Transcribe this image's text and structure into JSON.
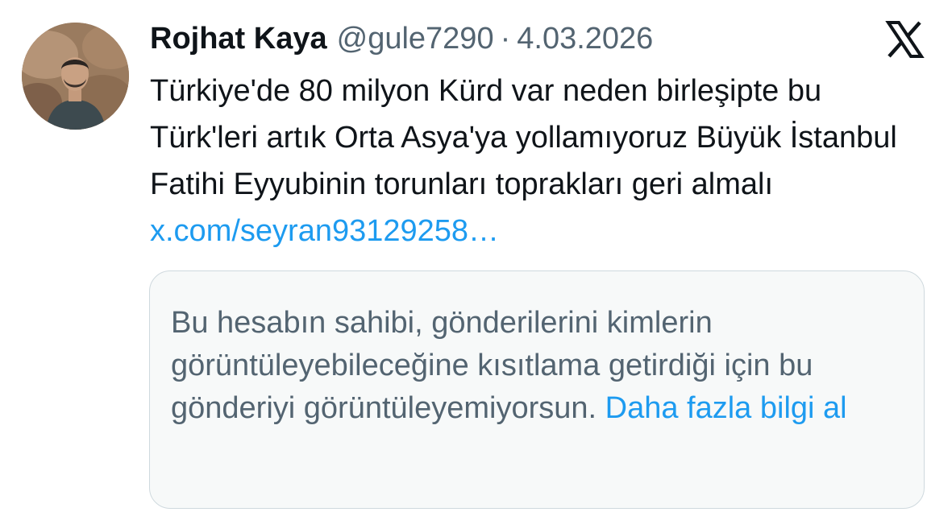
{
  "tweet": {
    "author": {
      "name": "Rojhat Kaya",
      "handle": "@gule7290",
      "avatar_icon": "profile-photo"
    },
    "separator": "·",
    "date": "4.03.2026",
    "brand_icon": "x-logo-icon",
    "text": "Türkiye'de 80 milyon Kürd var neden birleşipte bu Türk'leri artık Orta Asya'ya yollamıyoruz Büyük İstanbul Fatihi Eyyubinin torunları toprakları geri almalı",
    "link": "x.com/seyran93129258…",
    "quoted_notice": {
      "text": "Bu hesabın sahibi, gönderilerini kimlerin görüntüleyebileceğine kısıtlama getirdiği için bu gönderiyi görüntüleyemiyorsun.",
      "link_label": "Daha fazla bilgi al"
    }
  },
  "colors": {
    "text_primary": "#0f1419",
    "text_secondary": "#536471",
    "link": "#1d9bf0",
    "box_background": "#f7f9f9",
    "box_border": "#cfd9de"
  }
}
